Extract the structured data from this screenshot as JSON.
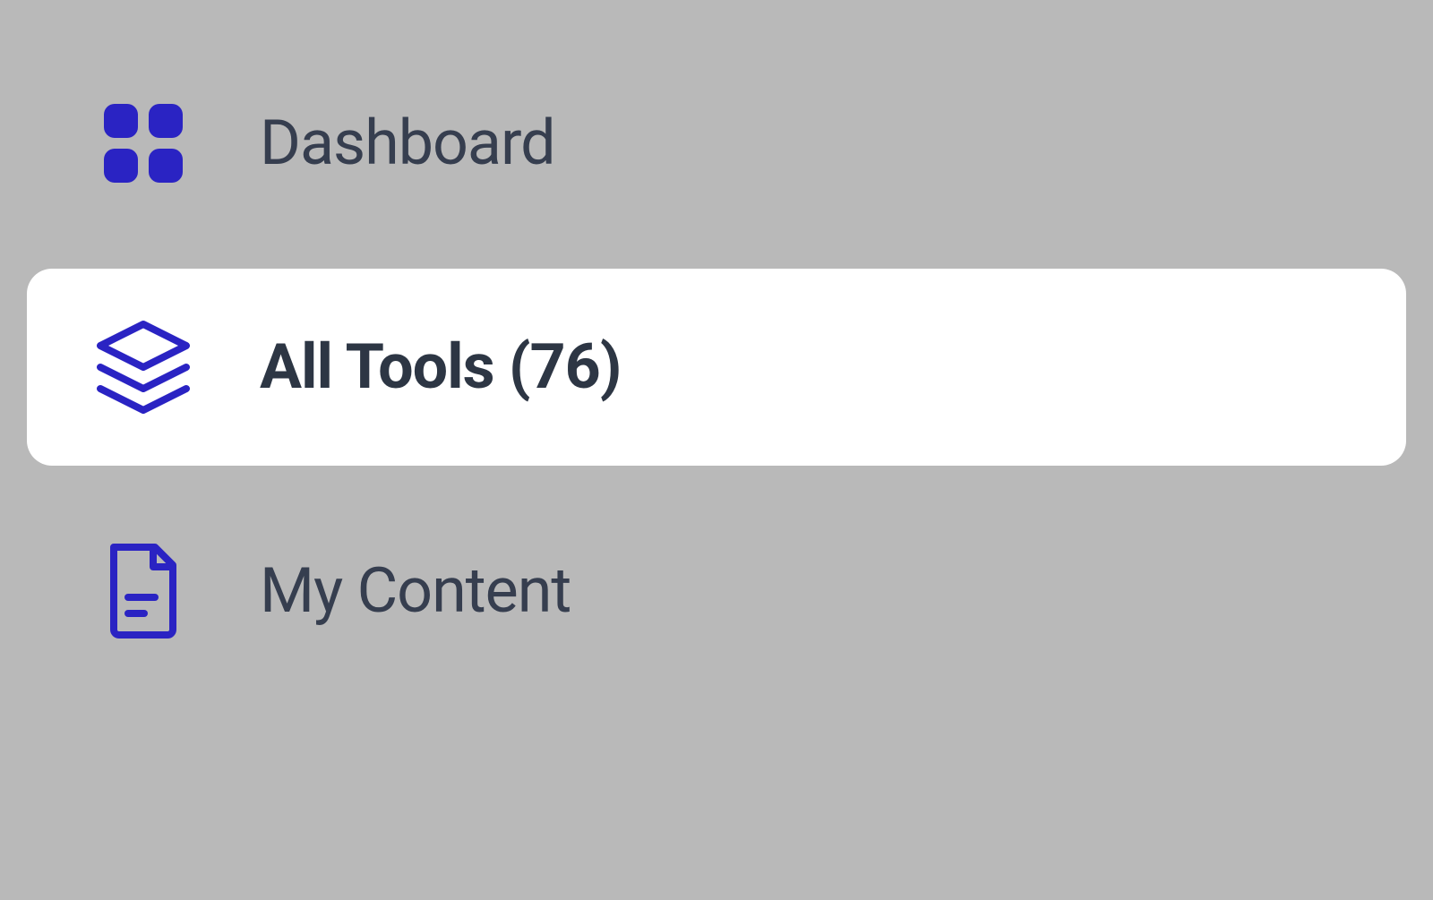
{
  "sidebar": {
    "items": [
      {
        "label": "Dashboard"
      },
      {
        "label": "All Tools (76)"
      },
      {
        "label": "My Content"
      }
    ]
  },
  "colors": {
    "icon": "#2a23c3",
    "text": "#363e4f",
    "background": "#b9b9b9",
    "activeBg": "#ffffff"
  }
}
